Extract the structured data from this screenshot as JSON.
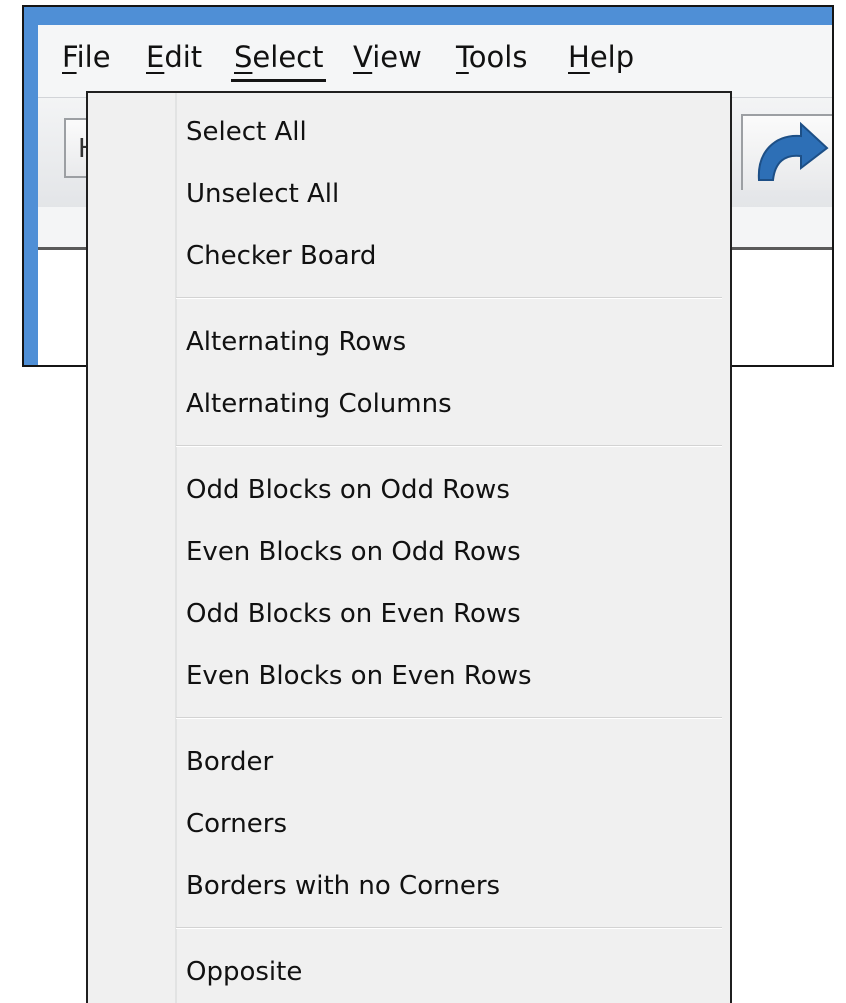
{
  "menubar": {
    "items": [
      {
        "label": "File",
        "accel": "F",
        "rest": "ile"
      },
      {
        "label": "Edit",
        "accel": "E",
        "rest": "dit"
      },
      {
        "label": "Select",
        "accel": "S",
        "rest": "elect",
        "open": true
      },
      {
        "label": "View",
        "accel": "V",
        "rest": "iew"
      },
      {
        "label": "Tools",
        "accel": "T",
        "rest": "ools"
      },
      {
        "label": "Help",
        "accel": "H",
        "rest": "elp"
      }
    ]
  },
  "toolbar": {
    "left_button_glyph": "H",
    "right_button_icon": "redo-arrow-icon"
  },
  "colors": {
    "window_border": "#4f8fd6",
    "menu_background": "#f0f0f0",
    "redo_icon": "#2d6fb6"
  },
  "select_menu": {
    "groups": [
      {
        "items": [
          "Select All",
          "Unselect All",
          "Checker Board"
        ]
      },
      {
        "items": [
          "Alternating Rows",
          "Alternating Columns"
        ]
      },
      {
        "items": [
          "Odd Blocks on Odd Rows",
          "Even Blocks on Odd Rows",
          "Odd Blocks on Even Rows",
          "Even Blocks on Even Rows"
        ]
      },
      {
        "items": [
          "Border",
          "Corners",
          "Borders with no Corners"
        ]
      },
      {
        "items": [
          "Opposite"
        ]
      }
    ]
  }
}
